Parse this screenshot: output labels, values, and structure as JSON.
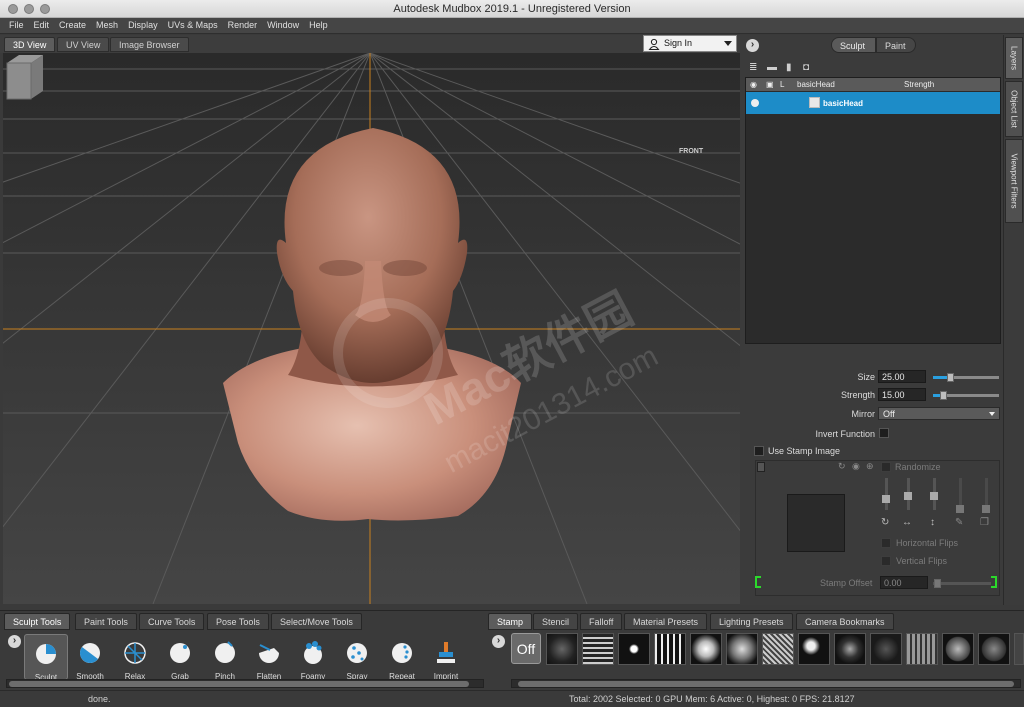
{
  "window": {
    "title": "Autodesk Mudbox 2019.1 - Unregistered Version"
  },
  "menu": [
    "File",
    "Edit",
    "Create",
    "Mesh",
    "Display",
    "UVs & Maps",
    "Render",
    "Window",
    "Help"
  ],
  "view_tabs": [
    "3D View",
    "UV View",
    "Image Browser"
  ],
  "sign_in": {
    "label": "Sign In"
  },
  "viewcube": {
    "face_label": "FRONT"
  },
  "watermark": {
    "line1": "Mac软件园",
    "line2": "macit201314.com"
  },
  "mode_toggle": {
    "sculpt": "Sculpt",
    "paint": "Paint"
  },
  "side_tabs": [
    "Layers",
    "Object List",
    "Viewport Filters"
  ],
  "layers": {
    "header": {
      "lock_col": "L",
      "name_col": "basicHead",
      "strength_col": "Strength"
    },
    "rows": [
      {
        "name": "basicHead"
      }
    ]
  },
  "properties": {
    "size_label": "Size",
    "size_value": "25.00",
    "size_fraction": 0.25,
    "strength_label": "Strength",
    "strength_value": "15.00",
    "strength_fraction": 0.15,
    "mirror_label": "Mirror",
    "mirror_value": "Off",
    "invert_label": "Invert Function",
    "use_stamp_label": "Use Stamp Image",
    "randomize_label": "Randomize",
    "horizontal_flips_label": "Horizontal Flips",
    "vertical_flips_label": "Vertical Flips",
    "stamp_offset_label": "Stamp Offset",
    "stamp_offset_value": "0.00"
  },
  "tool_tabs": [
    "Sculpt Tools",
    "Paint Tools",
    "Curve Tools",
    "Pose Tools",
    "Select/Move Tools"
  ],
  "tools": [
    {
      "label": "Sculpt",
      "icon": "sculpt-tool-icon"
    },
    {
      "label": "Smooth",
      "icon": "smooth-tool-icon"
    },
    {
      "label": "Relax",
      "icon": "relax-tool-icon"
    },
    {
      "label": "Grab",
      "icon": "grab-tool-icon"
    },
    {
      "label": "Pinch",
      "icon": "pinch-tool-icon"
    },
    {
      "label": "Flatten",
      "icon": "flatten-tool-icon"
    },
    {
      "label": "Foamy",
      "icon": "foamy-tool-icon"
    },
    {
      "label": "Spray",
      "icon": "spray-tool-icon"
    },
    {
      "label": "Repeat",
      "icon": "repeat-tool-icon"
    },
    {
      "label": "Imprint",
      "icon": "imprint-tool-icon"
    }
  ],
  "stamp_tabs": [
    "Stamp",
    "Stencil",
    "Falloff",
    "Material Presets",
    "Lighting Presets",
    "Camera Bookmarks"
  ],
  "stamp_off": "Off",
  "status": {
    "message": "done.",
    "stats": "Total: 2002  Selected: 0 GPU Mem: 6  Active: 0, Highest: 0  FPS: 21.8127"
  },
  "colors": {
    "accent": "#1d8cc8",
    "guide_line": "#c8801e",
    "head_skin": "#a86e5a"
  }
}
